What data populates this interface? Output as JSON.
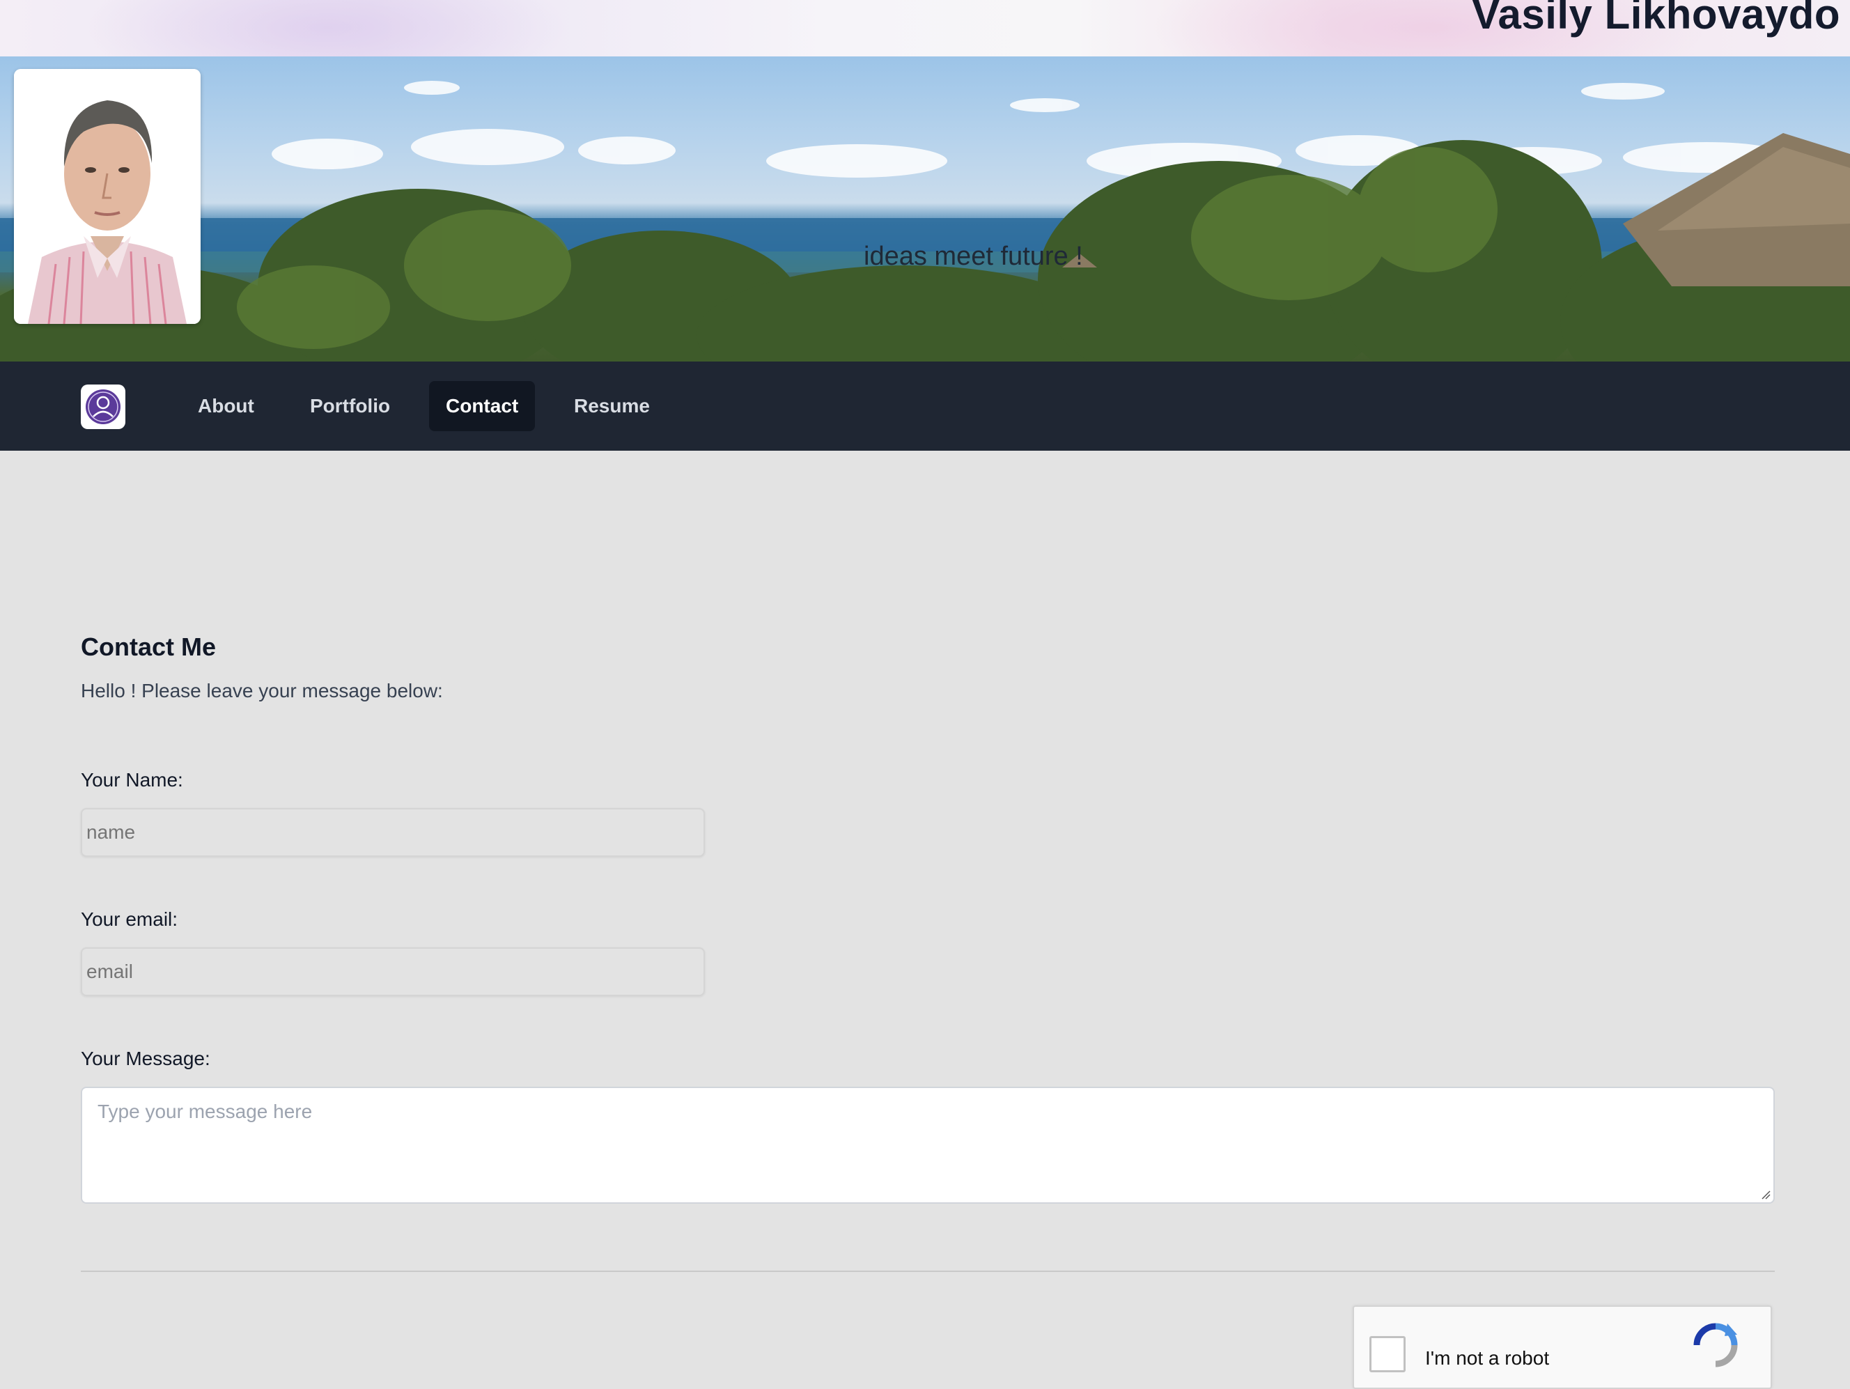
{
  "header": {
    "site_title": "Vasily Likhovaydo"
  },
  "banner": {
    "tagline": "ideas meet future !"
  },
  "nav": {
    "items": [
      {
        "label": "About",
        "active": false
      },
      {
        "label": "Portfolio",
        "active": false
      },
      {
        "label": "Contact",
        "active": true
      },
      {
        "label": "Resume",
        "active": false
      }
    ]
  },
  "contact": {
    "heading": "Contact Me",
    "intro": "Hello ! Please leave your message below:",
    "name_label": "Your Name:",
    "name_placeholder": "name",
    "email_label": "Your email:",
    "email_placeholder": "email",
    "message_label": "Your Message:",
    "message_placeholder": "Type your message here"
  },
  "captcha": {
    "label": "I'm not a robot"
  },
  "colors": {
    "nav_bg": "#1f2633",
    "nav_active_bg": "#111722",
    "page_bg": "#e3e3e3",
    "logo_accent": "#5b3a9a"
  },
  "icons": {
    "logo": "user-circle-icon",
    "captcha": "recaptcha-icon"
  }
}
